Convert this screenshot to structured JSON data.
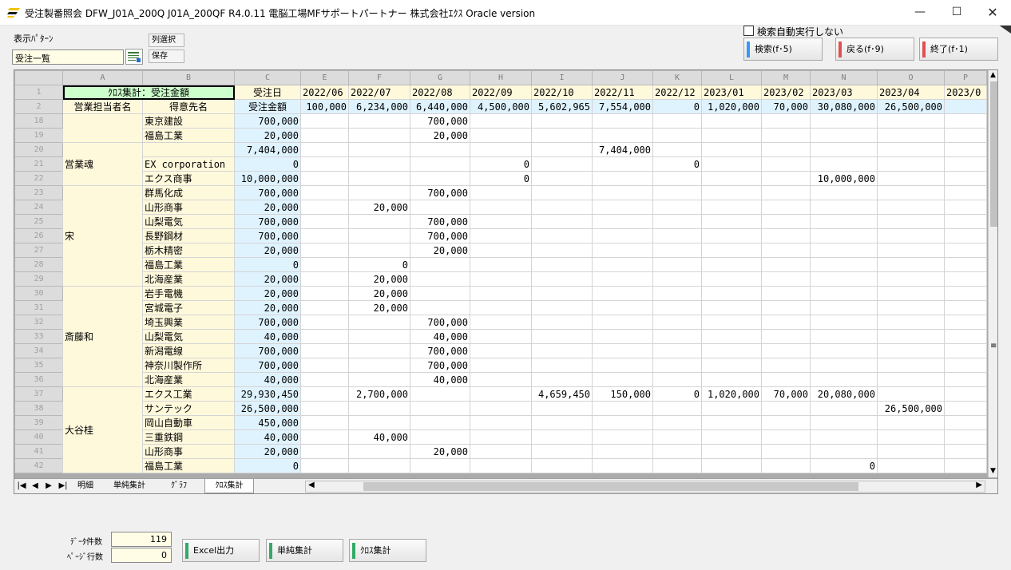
{
  "window": {
    "title": "受注製番照会  DFW_J01A_200Q  J01A_200QF  R4.0.11  電脳工場MFサポートパートナー  株式会社ｴｸｽ  Oracle version",
    "min": "—",
    "max": "☐",
    "close": "✕"
  },
  "controls": {
    "pattern_label": "表示ﾊﾟﾀｰﾝ",
    "pattern_value": "受注一覧",
    "col_select": "列選択",
    "save": "保存",
    "auto_search_label": "検索自動実行しない",
    "search_btn": "検索(f･5)",
    "back_btn": "戻る(f･9)",
    "exit_btn": "終了(f･1)"
  },
  "colors": {
    "blue_bar": "#3399ff",
    "red_bar": "#e05050",
    "green_bar": "#33aa66"
  },
  "sheet": {
    "col_letters": [
      "A",
      "B",
      "C",
      "E",
      "F",
      "G",
      "H",
      "I",
      "J",
      "K",
      "L",
      "M",
      "N",
      "O",
      "P"
    ],
    "row1": [
      "ｸﾛｽ集計：受注金額",
      "受注日",
      "2022/06",
      "2022/07",
      "2022/08",
      "2022/09",
      "2022/10",
      "2022/11",
      "2022/12",
      "2023/01",
      "2023/02",
      "2023/03",
      "2023/04",
      "2023/0"
    ],
    "row2": [
      "営業担当者名",
      "得意先名",
      "受注金額",
      "100,000",
      "6,234,000",
      "6,440,000",
      "4,500,000",
      "5,602,965",
      "7,554,000",
      "0",
      "1,020,000",
      "70,000",
      "30,080,000",
      "26,500,000",
      ""
    ],
    "groups": [
      {
        "name": "",
        "rows": [
          {
            "n": "18",
            "cells": [
              "東京建設",
              "700,000",
              "",
              "",
              "700,000",
              "",
              "",
              "",
              "",
              "",
              "",
              "",
              "",
              ""
            ]
          },
          {
            "n": "19",
            "cells": [
              "福島工業",
              "20,000",
              "",
              "",
              "20,000",
              "",
              "",
              "",
              "",
              "",
              "",
              "",
              "",
              ""
            ]
          }
        ]
      },
      {
        "name": "営業魂",
        "rows": [
          {
            "n": "20",
            "cells": [
              "",
              "7,404,000",
              "",
              "",
              "",
              "",
              "",
              "7,404,000",
              "",
              "",
              "",
              "",
              "",
              ""
            ]
          },
          {
            "n": "21",
            "cells": [
              "EX corporation",
              "0",
              "",
              "",
              "",
              "0",
              "",
              "",
              "0",
              "",
              "",
              "",
              "",
              ""
            ]
          },
          {
            "n": "22",
            "cells": [
              "エクス商事",
              "10,000,000",
              "",
              "",
              "",
              "0",
              "",
              "",
              "",
              "",
              "",
              "10,000,000",
              "",
              ""
            ]
          }
        ]
      },
      {
        "name": "宋",
        "rows": [
          {
            "n": "23",
            "cells": [
              "群馬化成",
              "700,000",
              "",
              "",
              "700,000",
              "",
              "",
              "",
              "",
              "",
              "",
              "",
              "",
              ""
            ]
          },
          {
            "n": "24",
            "cells": [
              "山形商事",
              "20,000",
              "",
              "20,000",
              "",
              "",
              "",
              "",
              "",
              "",
              "",
              "",
              "",
              ""
            ]
          },
          {
            "n": "25",
            "cells": [
              "山梨電気",
              "700,000",
              "",
              "",
              "700,000",
              "",
              "",
              "",
              "",
              "",
              "",
              "",
              "",
              ""
            ]
          },
          {
            "n": "26",
            "cells": [
              "長野鋼材",
              "700,000",
              "",
              "",
              "700,000",
              "",
              "",
              "",
              "",
              "",
              "",
              "",
              "",
              ""
            ]
          },
          {
            "n": "27",
            "cells": [
              "栃木精密",
              "20,000",
              "",
              "",
              "20,000",
              "",
              "",
              "",
              "",
              "",
              "",
              "",
              "",
              ""
            ]
          },
          {
            "n": "28",
            "cells": [
              "福島工業",
              "0",
              "",
              "0",
              "",
              "",
              "",
              "",
              "",
              "",
              "",
              "",
              "",
              ""
            ]
          },
          {
            "n": "29",
            "cells": [
              "北海産業",
              "20,000",
              "",
              "20,000",
              "",
              "",
              "",
              "",
              "",
              "",
              "",
              "",
              "",
              ""
            ]
          }
        ]
      },
      {
        "name": "斎藤和",
        "rows": [
          {
            "n": "30",
            "cells": [
              "岩手電機",
              "20,000",
              "",
              "20,000",
              "",
              "",
              "",
              "",
              "",
              "",
              "",
              "",
              "",
              ""
            ]
          },
          {
            "n": "31",
            "cells": [
              "宮城電子",
              "20,000",
              "",
              "20,000",
              "",
              "",
              "",
              "",
              "",
              "",
              "",
              "",
              "",
              ""
            ]
          },
          {
            "n": "32",
            "cells": [
              "埼玉興業",
              "700,000",
              "",
              "",
              "700,000",
              "",
              "",
              "",
              "",
              "",
              "",
              "",
              "",
              ""
            ]
          },
          {
            "n": "33",
            "cells": [
              "山梨電気",
              "40,000",
              "",
              "",
              "40,000",
              "",
              "",
              "",
              "",
              "",
              "",
              "",
              "",
              ""
            ]
          },
          {
            "n": "34",
            "cells": [
              "新潟電線",
              "700,000",
              "",
              "",
              "700,000",
              "",
              "",
              "",
              "",
              "",
              "",
              "",
              "",
              ""
            ]
          },
          {
            "n": "35",
            "cells": [
              "神奈川製作所",
              "700,000",
              "",
              "",
              "700,000",
              "",
              "",
              "",
              "",
              "",
              "",
              "",
              "",
              ""
            ]
          },
          {
            "n": "36",
            "cells": [
              "北海産業",
              "40,000",
              "",
              "",
              "40,000",
              "",
              "",
              "",
              "",
              "",
              "",
              "",
              "",
              ""
            ]
          }
        ]
      },
      {
        "name": "大谷桂",
        "rows": [
          {
            "n": "37",
            "cells": [
              "エクス工業",
              "29,930,450",
              "",
              "2,700,000",
              "",
              "",
              "4,659,450",
              "150,000",
              "0",
              "1,020,000",
              "70,000",
              "20,080,000",
              "",
              ""
            ]
          },
          {
            "n": "38",
            "cells": [
              "サンテック",
              "26,500,000",
              "",
              "",
              "",
              "",
              "",
              "",
              "",
              "",
              "",
              "",
              "26,500,000",
              ""
            ]
          },
          {
            "n": "39",
            "cells": [
              "岡山自動車",
              "450,000",
              "",
              "",
              "",
              "",
              "",
              "",
              "",
              "",
              "",
              "",
              "",
              ""
            ]
          },
          {
            "n": "40",
            "cells": [
              "三重鉄鋼",
              "40,000",
              "",
              "40,000",
              "",
              "",
              "",
              "",
              "",
              "",
              "",
              "",
              "",
              ""
            ]
          },
          {
            "n": "41",
            "cells": [
              "山形商事",
              "20,000",
              "",
              "",
              "20,000",
              "",
              "",
              "",
              "",
              "",
              "",
              "",
              "",
              ""
            ]
          },
          {
            "n": "42",
            "cells": [
              "福島工業",
              "0",
              "",
              "",
              "",
              "",
              "",
              "",
              "",
              "",
              "",
              "0",
              "",
              ""
            ]
          }
        ]
      }
    ],
    "tabs": [
      "明細",
      "単純集計",
      "ｸﾞﾗﾌ",
      "ｸﾛｽ集計"
    ],
    "nav": [
      "|◀",
      "◀",
      "▶",
      "▶|"
    ]
  },
  "footer": {
    "data_count_label": "ﾃﾞｰﾀ件数",
    "data_count": "119",
    "page_rows_label": "ﾍﾟｰｼﾞ行数",
    "page_rows": "0",
    "excel_btn": "Excel出力",
    "simple_btn": "単純集計",
    "cross_btn": "ｸﾛｽ集計"
  }
}
